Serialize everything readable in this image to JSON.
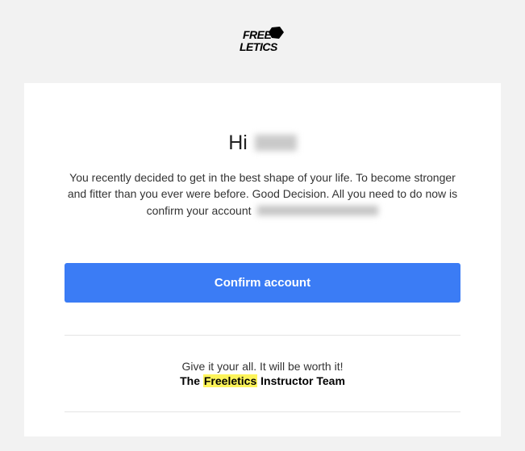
{
  "logo": {
    "alt": "Freeletics logo"
  },
  "greeting": {
    "prefix": "Hi "
  },
  "body": {
    "text": "You recently decided to get in the best shape of your life. To become stronger and fitter than you ever were before. Good Decision. All you need to do now is confirm your account "
  },
  "cta": {
    "label": "Confirm account"
  },
  "footer": {
    "line1": "Give it your all. It will be worth it!",
    "line2_prefix": "The ",
    "line2_brand": "Freeletics",
    "line2_suffix": " Instructor Team"
  }
}
